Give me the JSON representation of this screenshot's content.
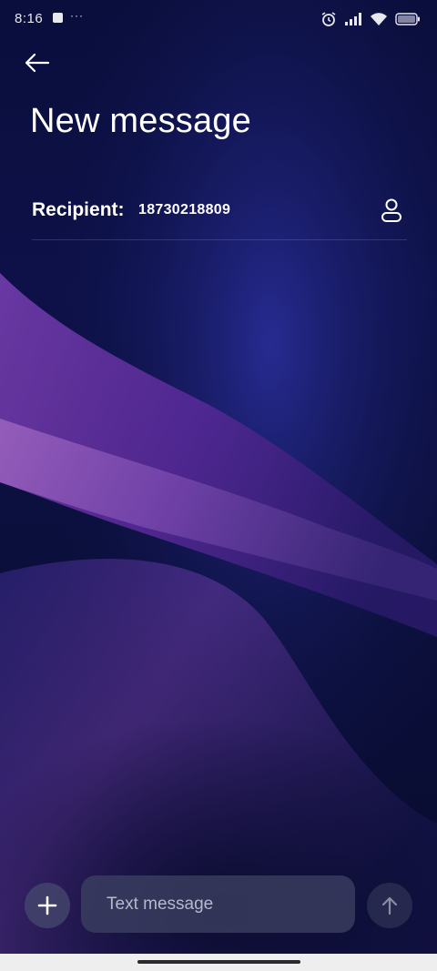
{
  "status_bar": {
    "time": "8:16",
    "overflow_dots": "···",
    "icons": [
      "notification-square-icon",
      "alarm-icon",
      "signal-icon",
      "wifi-icon",
      "battery-icon"
    ]
  },
  "header": {
    "back_icon": "arrow-left-icon",
    "title": "New message"
  },
  "recipient": {
    "label": "Recipient:",
    "value": "18730218809",
    "contact_icon": "person-icon"
  },
  "compose": {
    "attach_icon": "plus-icon",
    "placeholder": "Text message",
    "value": "",
    "send_icon": "arrow-up-icon"
  },
  "colors": {
    "background": "#0a0e3c",
    "text": "#ffffff",
    "input_bg": "#3c4062",
    "placeholder": "#b6b8cc",
    "nav_bar": "#eeeeef"
  }
}
